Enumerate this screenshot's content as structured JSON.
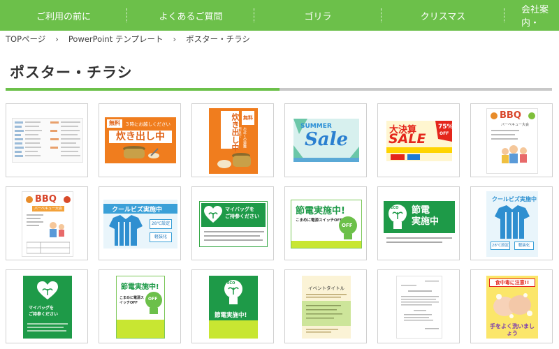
{
  "nav": {
    "items": [
      "ご利用の前に",
      "よくあるご質問",
      "ゴリラ",
      "クリスマス",
      "会社案内・"
    ],
    "color": "#6cc04a"
  },
  "breadcrumb": {
    "items": [
      "TOPページ",
      "PowerPoint テンプレート",
      "ポスター・チラシ"
    ],
    "separator": "›"
  },
  "page": {
    "title": "ポスター・チラシ"
  },
  "thumbs": {
    "takidashi_free": "無料",
    "takidashi_note": "３時にお越しください",
    "takidashi_main": "炊き出し中",
    "takidashi_v_note": "お近くの避難所まで",
    "takidashi_v_main": "炊き出し中",
    "summer_top": "SUMMER",
    "summer_sale": "Sale",
    "kessan_main": "大決算",
    "kessan_sale": "SALE",
    "kessan_off": "75%",
    "kessan_off2": "OFF",
    "bbq": "BBQ",
    "bbq_sub": "バーベキュー大会",
    "coolbiz": "クールビズ実施中",
    "coolbiz_badge1": "28℃設定",
    "coolbiz_badge2": "軽装化",
    "mybag": "マイバッグを\nご持参ください",
    "setsuden": "節電実施中!",
    "setsuden_sub": "こまめに電源スイッチOFF",
    "off": "OFF",
    "eco": "ECO",
    "setsuden2": "節電\n実施中",
    "event_title": "イベントタイトル",
    "food_poison": "食中毒に注意!!",
    "wash_hands": "手をよく洗いましょう"
  }
}
